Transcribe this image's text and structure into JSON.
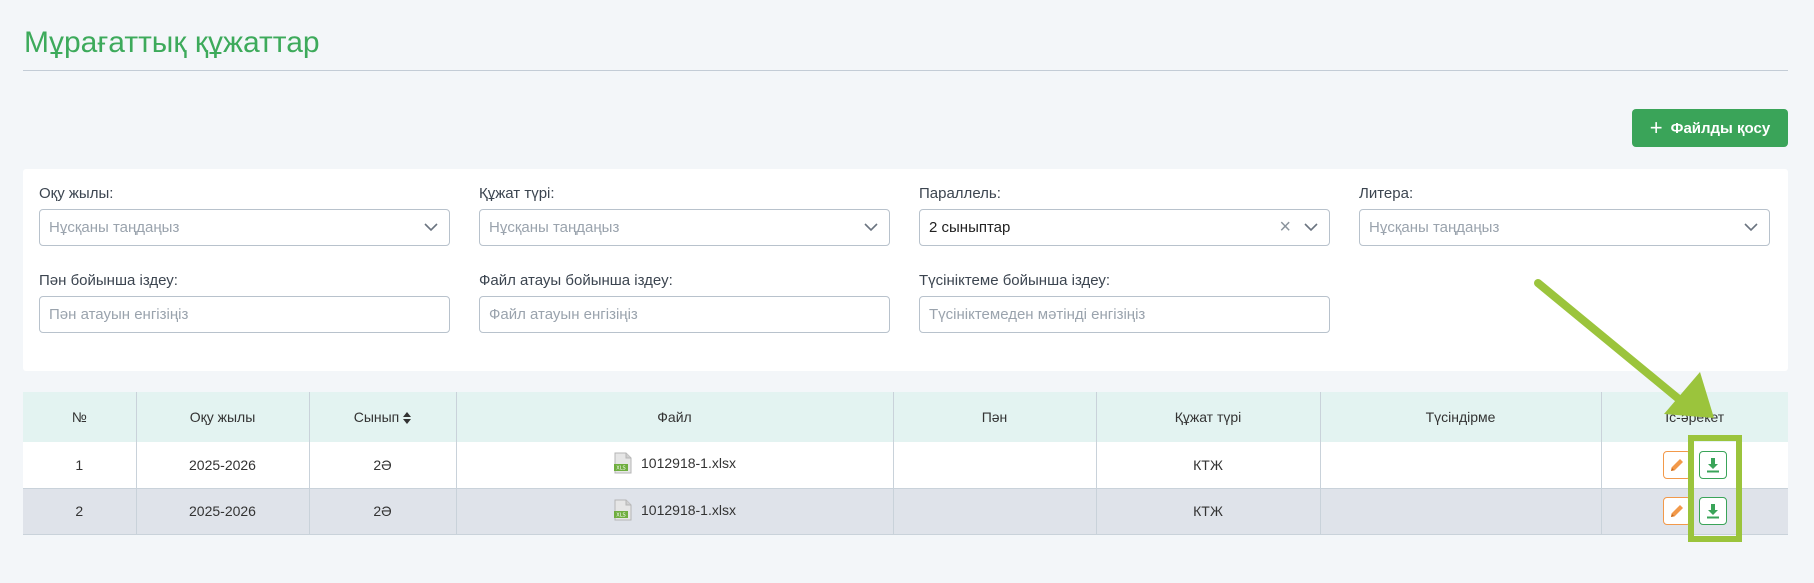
{
  "page": {
    "title": "Мұрағаттық құжаттар"
  },
  "toolbar": {
    "add_label": "Файлды қосу"
  },
  "filters": {
    "year": {
      "label": "Оқу жылы:",
      "placeholder": "Нұсқаны таңдаңыз"
    },
    "doc_type": {
      "label": "Құжат түрі:",
      "placeholder": "Нұсқаны таңдаңыз"
    },
    "parallel": {
      "label": "Параллель:",
      "value": "2 сыныптар"
    },
    "litera": {
      "label": "Литера:",
      "placeholder": "Нұсқаны таңдаңыз"
    },
    "subject_search": {
      "label": "Пән бойынша іздеу:",
      "placeholder": "Пән атауын енгізіңіз"
    },
    "file_search": {
      "label": "Файл атауы бойынша іздеу:",
      "placeholder": "Файл атауын енгізіңіз"
    },
    "comment_search": {
      "label": "Түсініктеме бойынша іздеу:",
      "placeholder": "Түсініктемеден мәтінді енгізіңіз"
    }
  },
  "table": {
    "headers": [
      "№",
      "Оқу жылы",
      "Сынып",
      "Файл",
      "Пән",
      "Құжат түрі",
      "Түсіндірме",
      "Іс-әрекет"
    ],
    "rows": [
      {
        "num": "1",
        "year": "2025-2026",
        "class": "2Ә",
        "file": "1012918-1.xlsx",
        "subject": "",
        "doc_type": "КТЖ",
        "comment": ""
      },
      {
        "num": "2",
        "year": "2025-2026",
        "class": "2Ә",
        "file": "1012918-1.xlsx",
        "subject": "",
        "doc_type": "КТЖ",
        "comment": ""
      }
    ]
  },
  "colors": {
    "accent": "#3aa459",
    "title": "#3daa5b",
    "annotation": "#9bc43c",
    "edit": "#f2994a"
  }
}
